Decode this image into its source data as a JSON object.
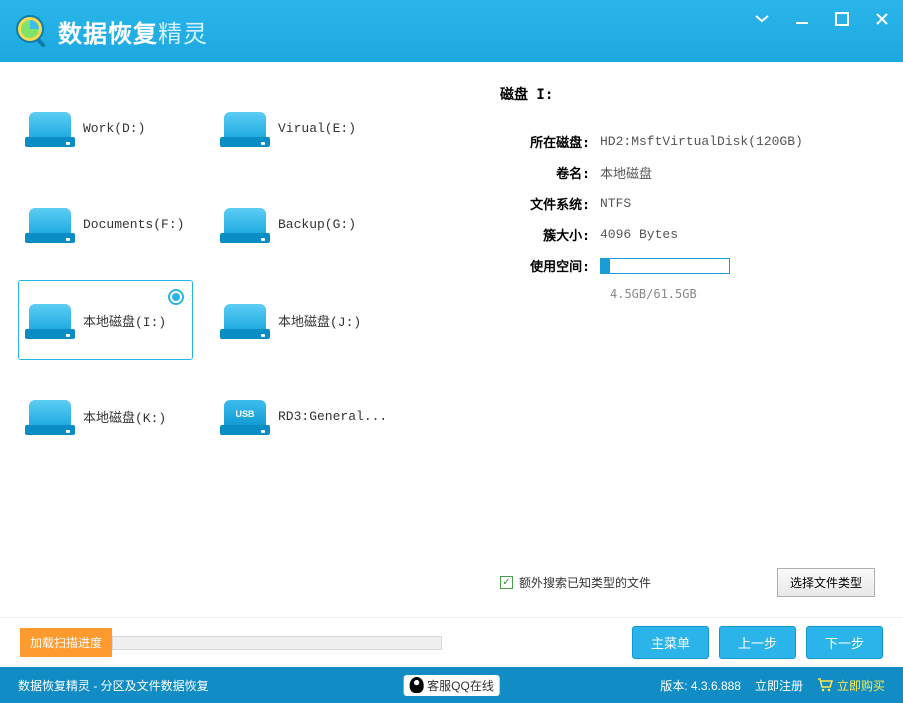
{
  "app": {
    "title_main": "数据恢复",
    "title_sub": "精灵"
  },
  "drives": [
    {
      "label": "Work(D:)",
      "type": "hdd"
    },
    {
      "label": "Virual(E:)",
      "type": "hdd"
    },
    {
      "label": "Documents(F:)",
      "type": "hdd"
    },
    {
      "label": "Backup(G:)",
      "type": "hdd"
    },
    {
      "label": "本地磁盘(I:)",
      "type": "hdd",
      "selected": true
    },
    {
      "label": "本地磁盘(J:)",
      "type": "hdd"
    },
    {
      "label": "本地磁盘(K:)",
      "type": "hdd"
    },
    {
      "label": "RD3:General...",
      "type": "usb"
    }
  ],
  "info": {
    "title": "磁盘 I:",
    "labels": {
      "disk": "所在磁盘:",
      "volume": "卷名:",
      "fs": "文件系统:",
      "cluster": "簇大小:",
      "usage": "使用空间:"
    },
    "disk": "HD2:MsftVirtualDisk(120GB)",
    "volume": "本地磁盘",
    "fs": "NTFS",
    "cluster": "4096 Bytes",
    "usage_text": "4.5GB/61.5GB",
    "usage_pct": 7
  },
  "extra": {
    "checkbox_label": "额外搜索已知类型的文件",
    "select_btn": "选择文件类型"
  },
  "bottom": {
    "progress_btn": "加载扫描进度",
    "menu": "主菜单",
    "prev": "上一步",
    "next": "下一步"
  },
  "footer": {
    "status": "数据恢复精灵 - 分区及文件数据恢复",
    "qq": "客服QQ在线",
    "version_label": "版本: ",
    "version": "4.3.6.888",
    "register": "立即注册",
    "buy": "立即购买"
  }
}
